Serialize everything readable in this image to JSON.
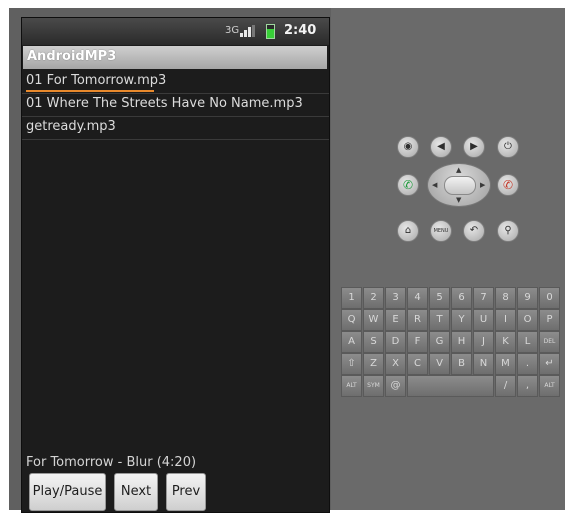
{
  "status_bar": {
    "network": "3G",
    "time": "2:40"
  },
  "app": {
    "title": "AndroidMP3"
  },
  "playlist": [
    {
      "label": "01 For Tomorrow.mp3"
    },
    {
      "label": "01 Where The Streets Have No Name.mp3"
    },
    {
      "label": "getready.mp3"
    }
  ],
  "now_playing": {
    "text": "For Tomorrow - Blur (4:20)"
  },
  "controls": {
    "play_pause": "Play/Pause",
    "next": "Next",
    "prev": "Prev"
  },
  "emulator": {
    "menu_label": "MENU",
    "keyboard_rows": [
      [
        "1",
        "2",
        "3",
        "4",
        "5",
        "6",
        "7",
        "8",
        "9",
        "0"
      ],
      [
        "Q",
        "W",
        "E",
        "R",
        "T",
        "Y",
        "U",
        "I",
        "O",
        "P"
      ],
      [
        "A",
        "S",
        "D",
        "F",
        "G",
        "H",
        "J",
        "K",
        "L",
        "DEL"
      ],
      [
        "⇧",
        "Z",
        "X",
        "C",
        "V",
        "B",
        "N",
        "M",
        ".",
        "↵"
      ],
      [
        "ALT",
        "SYM",
        "@",
        "",
        "",
        "",
        "/",
        "?",
        ",",
        "ALT"
      ]
    ]
  },
  "colors": {
    "accent_underline": "#e8892c",
    "title_bar": "#b8b8b8",
    "screen_bg": "#1c1c1c"
  }
}
